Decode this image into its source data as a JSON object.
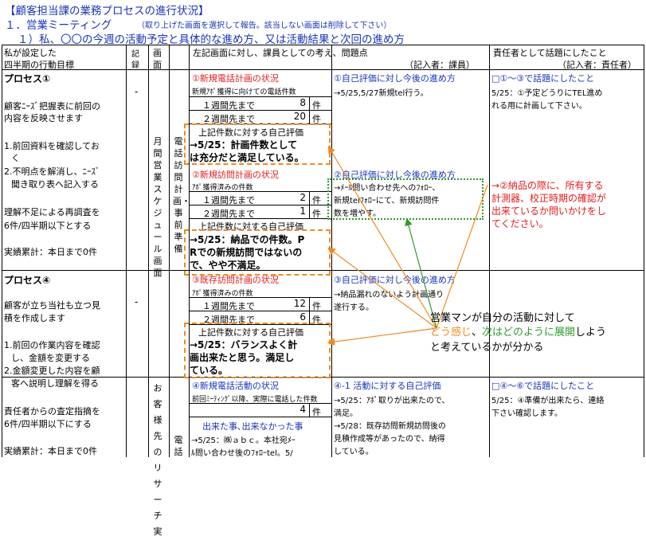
{
  "header": {
    "title": "【顧客担当課の業務プロセスの進行状況】",
    "sub1_main": "１．営業ミーティング",
    "sub1_note": "（取り上げた画面を選択して報告。該当しない画面は削除して下さい）",
    "sub2": "１）私、〇〇の今週の活動予定と具体的な進め方、又は活動結果と次回の進め方"
  },
  "columns": {
    "c1a": "私が設定した",
    "c1b": "四半期の行動目標",
    "c2a": "記",
    "c2b": "録",
    "c3a": "画",
    "c3b": "面",
    "c4": "左記画面に対し、課員としての考え、問題点",
    "c4_note": "（記入者：課員）",
    "c6": "責任者として話題にしたこと",
    "c6_note": "（記入者：責任者）"
  },
  "col1": {
    "p1_head": "プロセス①",
    "p1_l1": "顧客ﾆｰｽﾞ把握表に前回の",
    "p1_l2": "内容を反映させます",
    "p1_l3": "1.前回資料を確認してお",
    "p1_l4": "く",
    "p1_l5": "2.不明点を解消し、ﾆｰｽﾞ",
    "p1_l6": "聞き取り表へ記入する",
    "p1_l7": "理解不足による再調査を",
    "p1_l8": "6件/四半期以下とする",
    "p1_l9": "実績累計：本日まで0件",
    "p4_head": "プロセス④",
    "p4_l1": "顧客が立ち当社も立つ見",
    "p4_l2": "積を作成します",
    "p4_l3": "1.前回の作業内容を確認",
    "p4_l4": "し、金額を変更する",
    "p4_l5": "2.金額変更した内容を顧",
    "p4_l6": "客へ説明し理解を得る",
    "p4_l7": "責任者からの査定指摘を",
    "p4_l8": "6件/四半期以下にする",
    "p4_l9": "実績累計：本日まで0件"
  },
  "col2": {
    "dash1": "-",
    "dash2": "-"
  },
  "col3": {
    "v1": "月間営業スケジュール画面",
    "v2": "お客様先のリサーチ実",
    "v4": "電話訪問計画・事前準備",
    "v5": "電話"
  },
  "col4": {
    "s1_title": "①新規電話計画の状況",
    "s1_sub": "新規ｱﾎﾟ獲得に向けての電話件数",
    "r1_label": "１週間先まで",
    "r1_val": "8",
    "r1_unit": "件",
    "r2_label": "２週間先まで",
    "r2_val": "20",
    "r2_unit": "件",
    "e1_head": "上記件数に対する自己評価",
    "e1_b1": "→5/25：計画件数として",
    "e1_b2": "は充分だと満足している。",
    "s2_title": "②新規訪問計画の状況",
    "s2_sub": "ｱﾎﾟ獲得済みの件数",
    "r3_label": "１週間先まで",
    "r3_val": "2",
    "r3_unit": "件",
    "r4_label": "２週間先まで",
    "r4_val": "1",
    "r4_unit": "件",
    "e2_head": "上記件数に対する自己評価",
    "e2_b1": "→5/25：納品での件数。P",
    "e2_b2": "Rでの新規訪問ではないの",
    "e2_b3": "で、やや不満足。",
    "s3_title": "③既存訪問計画の状況",
    "s3_sub": "ｱﾎﾟ獲得済みの件数",
    "r5_label": "１週間先まで",
    "r5_val": "12",
    "r5_unit": "件",
    "r6_label": "２週間先まで",
    "r6_val": "6",
    "r6_unit": "件",
    "e3_head": "上記件数に対する自己評価",
    "e3_b1": "→5/25：バランスよく計",
    "e3_b2": "画出来たと思う。満足し",
    "e3_b3": "ている。",
    "s4_title": "④新規電話活動の状況",
    "s4_sub": "前回ﾐｰﾃｨﾝｸﾞ以降、実際に電話した件数",
    "r7_val": "4",
    "r7_unit": "件",
    "s4_done": "出来た事､出来なかった事",
    "s4_l1": "→5/25：㈱ａｂｃ。本社宛ﾒｰ",
    "s4_l2": "ﾙ問い合わせ後のﾌｫﾛｰtel。5/"
  },
  "col5": {
    "s1_title": "①自己評価に対し今後の進め方",
    "s1_l1": "→5/25,5/27新規tel行う。",
    "s2_title": "②自己評価に対し今後の進め方",
    "s2_l1": "→ﾒｰﾙ問い合わせ先へのﾌｫﾛｰ、",
    "s2_l2": "新規telﾌｫﾛｰにて、新規訪問件",
    "s2_l3": "数を増やす。",
    "s3_title": "③自己評価に対し今後の進め方",
    "s3_l1": "→納品漏れのないよう計画通り",
    "s3_l2": "遂行する。",
    "s4_title": "④-1 活動に対する自己評価",
    "s4_l1": "→5/25：ｱﾎﾟ取りが出来たので、",
    "s4_l2": "満足。",
    "s4_l3": "→5/28：既存訪問新規訪問後の",
    "s4_l4": "見積作成等があったので、納得",
    "s4_l5": "している。"
  },
  "col6": {
    "h1": "□①～③で話題にしたこと",
    "l1": "5/25：①予定どうりにTEL進め",
    "l2": "れる用に計画して下さい。",
    "red1": "→②納品の際に、所有する",
    "red2": "計測器、校正時期の確認が",
    "red3": "出来ているか問いかけをし",
    "red4": "てください。",
    "h2": "□④～⑥で話題にしたこと",
    "l3": "5/25：④準備が出来たら、連絡",
    "l4": "下さい確認します。"
  },
  "callout": {
    "line1": "営業マンが自分の活動に対して",
    "orange": "どう感じ",
    "sep": "、",
    "green": "次はどのように展開",
    "tail": "しよう",
    "line3": "と考えているかが分かる"
  },
  "colors": {
    "orange": "#f08a24",
    "green": "#2f9a2f",
    "red": "#e21b1b",
    "blue": "#1a35b8"
  }
}
